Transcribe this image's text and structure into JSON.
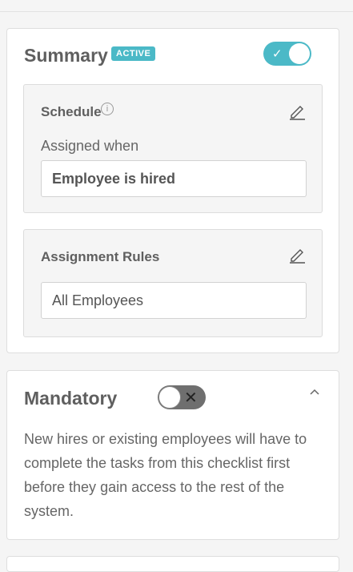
{
  "summary": {
    "title": "Summary",
    "badge": "ACTIVE",
    "toggle_on": true,
    "schedule": {
      "title": "Schedule",
      "info_icon": "info-icon",
      "label": "Assigned when",
      "value": "Employee is hired"
    },
    "rules": {
      "title": "Assignment Rules",
      "value": "All Employees"
    }
  },
  "mandatory": {
    "title": "Mandatory",
    "toggle_on": false,
    "description": "New hires or existing employees will have to complete the tasks from this checklist first before they gain access to the rest of the system."
  },
  "colors": {
    "accent": "#4bb9c7",
    "toggle_off": "#6f6f6f"
  }
}
